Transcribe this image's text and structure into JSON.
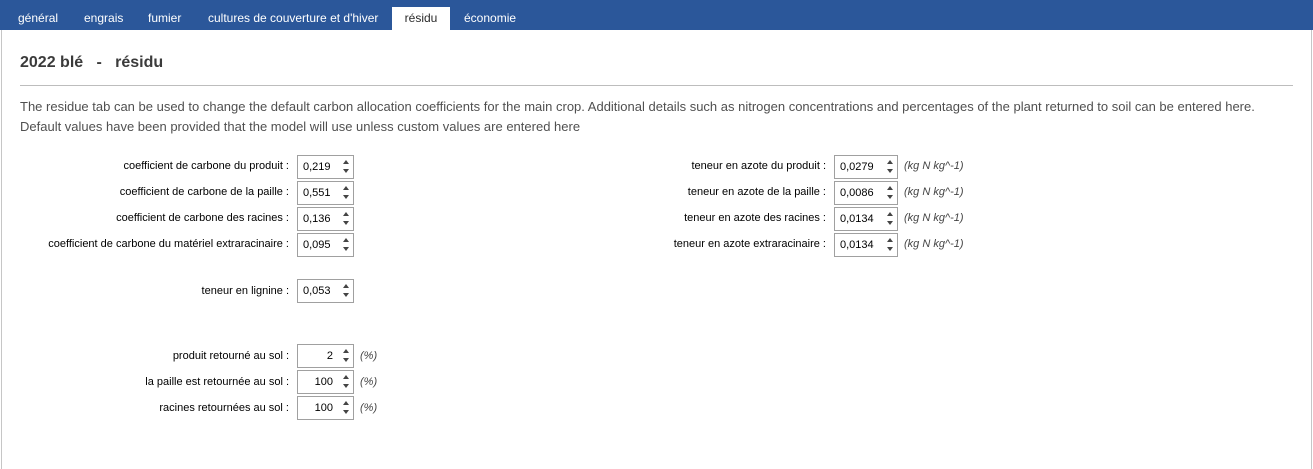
{
  "tabs": [
    {
      "label": "général"
    },
    {
      "label": "engrais"
    },
    {
      "label": "fumier"
    },
    {
      "label": "cultures de couverture et d'hiver"
    },
    {
      "label": "résidu"
    },
    {
      "label": "économie"
    }
  ],
  "heading": "2022 blé   -   résidu",
  "description": "The residue tab can be used to change the default carbon allocation coefficients for the main crop. Additional details such as nitrogen concentrations and percentages of the plant returned to soil can be entered here. Default values have been provided that the model will use unless custom values are entered here",
  "carbon": [
    {
      "label": "coefficient de carbone du produit :",
      "value": "0,219"
    },
    {
      "label": "coefficient de carbone de la paille :",
      "value": "0,551"
    },
    {
      "label": "coefficient de carbone des racines :",
      "value": "0,136"
    },
    {
      "label": "coefficient de carbone du matériel extraracinaire :",
      "value": "0,095"
    }
  ],
  "lignin": {
    "label": "teneur en lignine :",
    "value": "0,053"
  },
  "nitrogen": [
    {
      "label": "teneur en azote du produit :",
      "value": "0,0279",
      "unit": "(kg N kg^-1)"
    },
    {
      "label": "teneur en azote de la paille :",
      "value": "0,0086",
      "unit": "(kg N kg^-1)"
    },
    {
      "label": "teneur en azote des racines :",
      "value": "0,0134",
      "unit": "(kg N kg^-1)"
    },
    {
      "label": "teneur en azote extraracinaire :",
      "value": "0,0134",
      "unit": "(kg N kg^-1)"
    }
  ],
  "returned": [
    {
      "label": "produit retourné au sol :",
      "value": "2",
      "unit": "(%)"
    },
    {
      "label": "la paille est retournée au sol :",
      "value": "100",
      "unit": "(%)"
    },
    {
      "label": "racines retournées au sol :",
      "value": "100",
      "unit": "(%)"
    }
  ]
}
